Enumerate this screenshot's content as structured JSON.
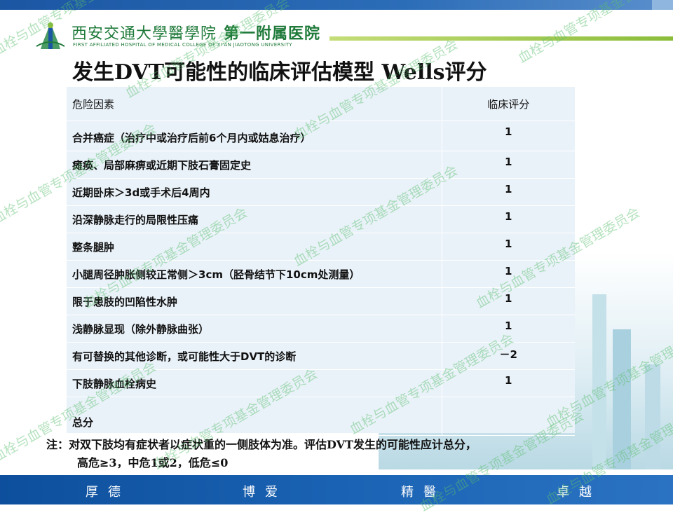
{
  "header": {
    "logo_cn": "西安交通大學醫學院",
    "hospital_name": "第一附属医院",
    "logo_en": "FIRST AFFILIATED HOSPITAL OF MEDICAL COLLEGE OF XI'AN JIAOTONG UNIVERSITY",
    "logo_icon": "hospital-emblem-icon"
  },
  "title": "发生DVT可能性的临床评估模型   Wells评分",
  "table": {
    "col_risk": "危险因素",
    "col_score": "临床评分",
    "rows": [
      {
        "factor": "合并癌症（治疗中或治疗后前6个月内或姑息治疗）",
        "score": "1"
      },
      {
        "factor": "瘫痪、局部麻痹或近期下肢石膏固定史",
        "score": "1"
      },
      {
        "factor": "近期卧床＞3d或手术后4周内",
        "score": "1"
      },
      {
        "factor": "沿深静脉走行的局限性压痛",
        "score": "1"
      },
      {
        "factor": "整条腿肿",
        "score": "1"
      },
      {
        "factor": "小腿周径肿胀侧较正常侧＞3cm（胫骨结节下10cm处测量）",
        "score": "1"
      },
      {
        "factor": "限于患肢的凹陷性水肿",
        "score": "1"
      },
      {
        "factor": "浅静脉显现（除外静脉曲张）",
        "score": "1"
      },
      {
        "factor": "有可替换的其他诊断，或可能性大于DVT的诊断",
        "score": "－2"
      },
      {
        "factor": "下肢静脉血栓病史",
        "score": "1"
      },
      {
        "factor": "总分",
        "score": ""
      }
    ]
  },
  "note": {
    "line1": "注：对双下肢均有症状者以症状重的一侧肢体为准。评估DVT发生的可能性应计总分，",
    "line2": "高危≥3，中危1或2，低危≤0"
  },
  "footer": {
    "motto": [
      "厚德",
      "博爱",
      "精醫",
      "卓越"
    ]
  },
  "watermark": "血栓与血管专项基金管理委员会",
  "colors": {
    "top_bar": "#1b56a3",
    "footer_bar": "#0d4f9c",
    "table_bg": "#eaf2f9",
    "logo_green": "#1f7a3a",
    "accent_line": "#8bbd3a",
    "watermark": "#5abe6e"
  }
}
